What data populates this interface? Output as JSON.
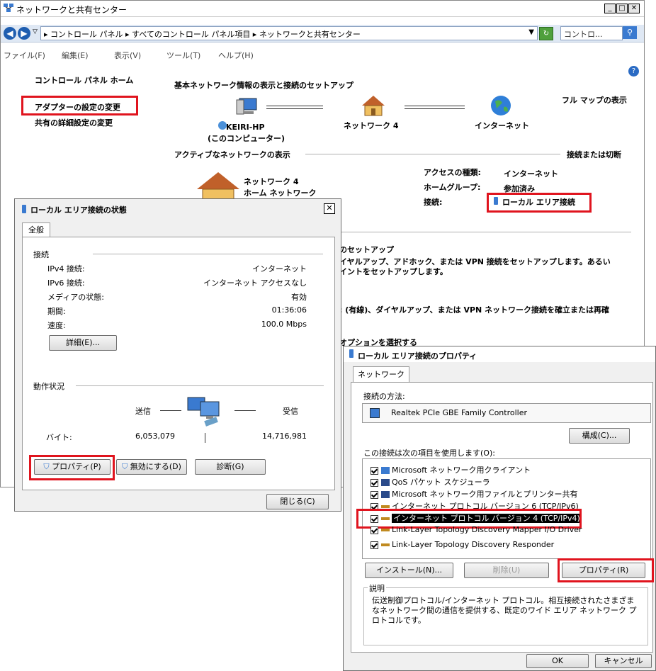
{
  "main": {
    "title": "ネットワークと共有センター",
    "breadcrumb": "▸ コントロール パネル ▸ すべてのコントロール パネル項目 ▸ ネットワークと共有センター",
    "search_placeholder": "コントロ...",
    "menu": [
      "ファイル(F)",
      "編集(E)",
      "表示(V)",
      "ツール(T)",
      "ヘルプ(H)"
    ],
    "sidebar": {
      "home": "コントロール パネル ホーム",
      "adapter": "アダプターの設定の変更",
      "sharing": "共有の詳細設定の変更"
    },
    "heading": "基本ネットワーク情報の表示と接続のセットアップ",
    "full_map": "フル マップの表示",
    "map": {
      "computer": "KEIRI-HP",
      "computer_sub": "(このコンピューター)",
      "network": "ネットワーク 4",
      "internet": "インターネット"
    },
    "active_header": "アクティブなネットワークの表示",
    "connect_disconnect": "接続または切断",
    "network_name": "ネットワーク 4",
    "network_type": "ホーム ネットワーク",
    "access_type_label": "アクセスの種類:",
    "access_type_value": "インターネット",
    "homegroup_label": "ホームグループ:",
    "homegroup_value": "参加済み",
    "connection_label": "接続:",
    "connection_value": "ローカル エリア接続",
    "setup_title": "のセットアップ",
    "setup_desc1": "イヤルアップ、アドホック、または VPN 接続をセットアップします。あるい",
    "setup_desc2": "イントをセットアップします。",
    "reconnect_desc": ": (有線)、ダイヤルアップ、または VPN ネットワーク接続を確立または再確",
    "options_partial": "オプションを選択する"
  },
  "status": {
    "title": "ローカル エリア接続の状態",
    "tab": "全般",
    "connection_header": "接続",
    "rows": [
      {
        "label": "IPv4 接続:",
        "value": "インターネット"
      },
      {
        "label": "IPv6 接続:",
        "value": "インターネット アクセスなし"
      },
      {
        "label": "メディアの状態:",
        "value": "有効"
      },
      {
        "label": "期間:",
        "value": "01:36:06"
      },
      {
        "label": "速度:",
        "value": "100.0 Mbps"
      }
    ],
    "details_button": "詳細(E)...",
    "activity_header": "動作状況",
    "sent": "送信",
    "received": "受信",
    "bytes_label": "バイト:",
    "bytes_sent": "6,053,079",
    "bytes_received": "14,716,981",
    "properties_button": "プロパティ(P)",
    "disable_button": "無効にする(D)",
    "diagnose_button": "診断(G)",
    "close_button": "閉じる(C)"
  },
  "props": {
    "title": "ローカル エリア接続のプロパティ",
    "tab": "ネットワーク",
    "connect_using": "接続の方法:",
    "adapter": "Realtek PCIe GBE Family Controller",
    "configure_button": "構成(C)...",
    "items_label": "この接続は次の項目を使用します(O):",
    "items": [
      "Microsoft ネットワーク用クライアント",
      "QoS パケット スケジューラ",
      "Microsoft ネットワーク用ファイルとプリンター共有",
      "インターネット プロトコル バージョン 6 (TCP/IPv6)",
      "インターネット プロトコル バージョン 4 (TCP/IPv4)",
      "Link-Layer Topology Discovery Mapper I/O Driver",
      "Link-Layer Topology Discovery Responder"
    ],
    "install_button": "インストール(N)...",
    "uninstall_button": "削除(U)",
    "properties_button": "プロパティ(R)",
    "description_label": "説明",
    "description": "伝送制御プロトコル/インターネット プロトコル。相互接続されたさまざまなネットワーク間の通信を提供する、既定のワイド エリア ネットワーク プロトコルです。",
    "ok_button": "OK",
    "cancel_button": "キャンセル"
  }
}
